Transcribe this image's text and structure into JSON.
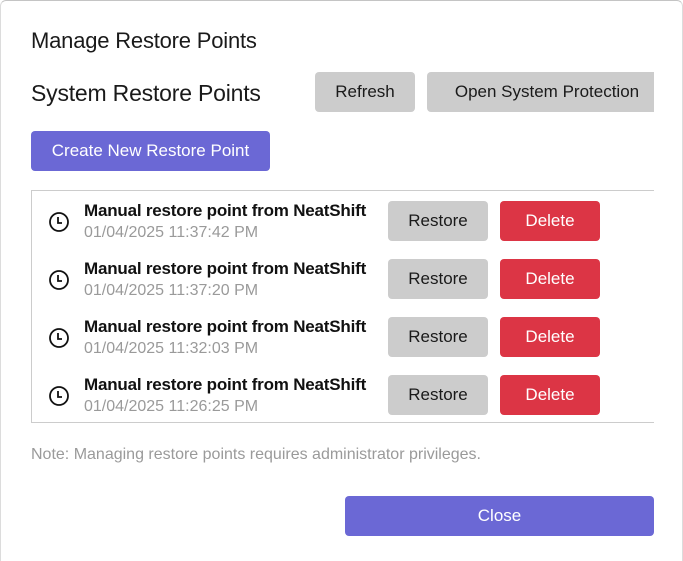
{
  "dialog": {
    "title": "Manage Restore Points",
    "section_title": "System Restore Points",
    "refresh_label": "Refresh",
    "open_system_protection_label": "Open System Protection",
    "create_label": "Create New Restore Point",
    "note": "Note: Managing restore points requires administrator privileges.",
    "close_label": "Close"
  },
  "restore_points": [
    {
      "name": "Manual restore point from NeatShift",
      "date": "01/04/2025 11:37:42 PM",
      "icon": "clock-icon",
      "restore_label": "Restore",
      "delete_label": "Delete"
    },
    {
      "name": "Manual restore point from NeatShift",
      "date": "01/04/2025 11:37:20 PM",
      "icon": "clock-icon",
      "restore_label": "Restore",
      "delete_label": "Delete"
    },
    {
      "name": "Manual restore point from NeatShift",
      "date": "01/04/2025 11:32:03 PM",
      "icon": "clock-icon",
      "restore_label": "Restore",
      "delete_label": "Delete"
    },
    {
      "name": "Manual restore point from NeatShift",
      "date": "01/04/2025 11:26:25 PM",
      "icon": "clock-icon",
      "restore_label": "Restore",
      "delete_label": "Delete"
    }
  ],
  "colors": {
    "accent": "#6b68d5",
    "danger": "#dc3545",
    "neutral_button": "#cccccc",
    "muted_text": "#9a9a9a"
  }
}
